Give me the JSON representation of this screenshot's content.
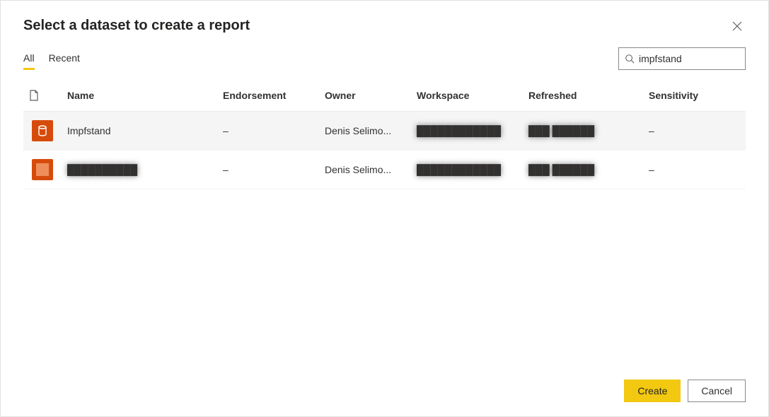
{
  "dialog": {
    "title": "Select a dataset to create a report"
  },
  "tabs": {
    "all": "All",
    "recent": "Recent",
    "active": "all"
  },
  "search": {
    "value": "impfstand"
  },
  "columns": {
    "name": "Name",
    "endorsement": "Endorsement",
    "owner": "Owner",
    "workspace": "Workspace",
    "refreshed": "Refreshed",
    "sensitivity": "Sensitivity"
  },
  "rows": [
    {
      "name": "Impfstand",
      "endorsement": "–",
      "owner": "Denis Selimo...",
      "workspace": "████████████",
      "refreshed": "███ ██████",
      "sensitivity": "–",
      "selected": true,
      "icon": "dataset"
    },
    {
      "name": "██████████",
      "endorsement": "–",
      "owner": "Denis Selimo...",
      "workspace": "████████████",
      "refreshed": "███ ██████",
      "sensitivity": "–",
      "selected": false,
      "icon": "square"
    }
  ],
  "footer": {
    "create": "Create",
    "cancel": "Cancel"
  }
}
